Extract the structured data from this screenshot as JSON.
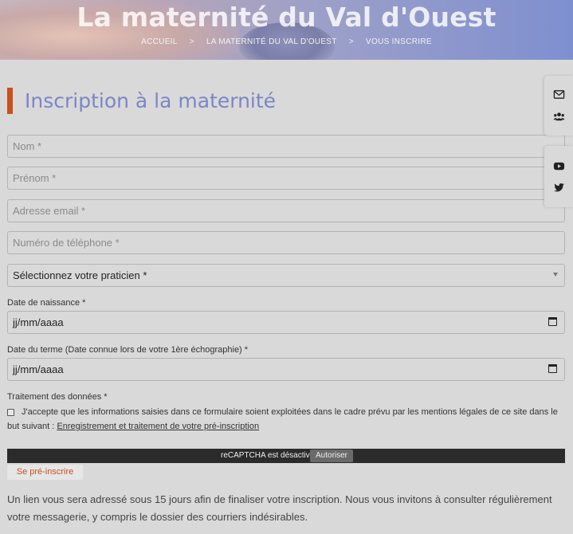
{
  "hero": {
    "title": "La maternité du Val d'Ouest",
    "breadcrumb": [
      "ACCUEIL",
      "LA MATERNITÉ DU VAL D'OUEST",
      "VOUS INSCRIRE"
    ],
    "breadcrumb_separator": ">"
  },
  "page_title": "Inscription à la maternité",
  "form": {
    "nom_placeholder": "Nom *",
    "prenom_placeholder": "Prénom *",
    "email_placeholder": "Adresse email *",
    "phone_placeholder": "Numéro de téléphone *",
    "praticien_select": "Sélectionnez votre praticien *",
    "birth_label": "Date de naissance *",
    "birth_value": "jj/mm/aaaa",
    "term_label": "Date du terme (Date connue lors de votre 1ère échographie) *",
    "term_value": "jj/mm/aaaa",
    "consent_section_label": "Traitement des données *",
    "consent_text": "J'accepte que les informations saisies dans ce formulaire soient exploitées dans le cadre prévu par les mentions légales de ce site dans le but suivant : ",
    "consent_link": "Enregistrement et traitement de votre pré-inscription",
    "captcha_text": "reCAPTCHA est désactivé.",
    "captcha_button": "Autoriser",
    "submit_label": "Se pré-inscrire"
  },
  "info_text": "Un lien vous sera adressé sous 15 jours afin de finaliser votre inscription. Nous vous invitons à consulter régulièrement votre messagerie, y compris le dossier des courriers indésirables.",
  "side_icons": [
    "envelope-icon",
    "users-icon",
    "youtube-icon",
    "twitter-icon"
  ],
  "colors": {
    "accent": "#c8501c",
    "title": "#7c86c6",
    "background": "#d9d9d9"
  }
}
